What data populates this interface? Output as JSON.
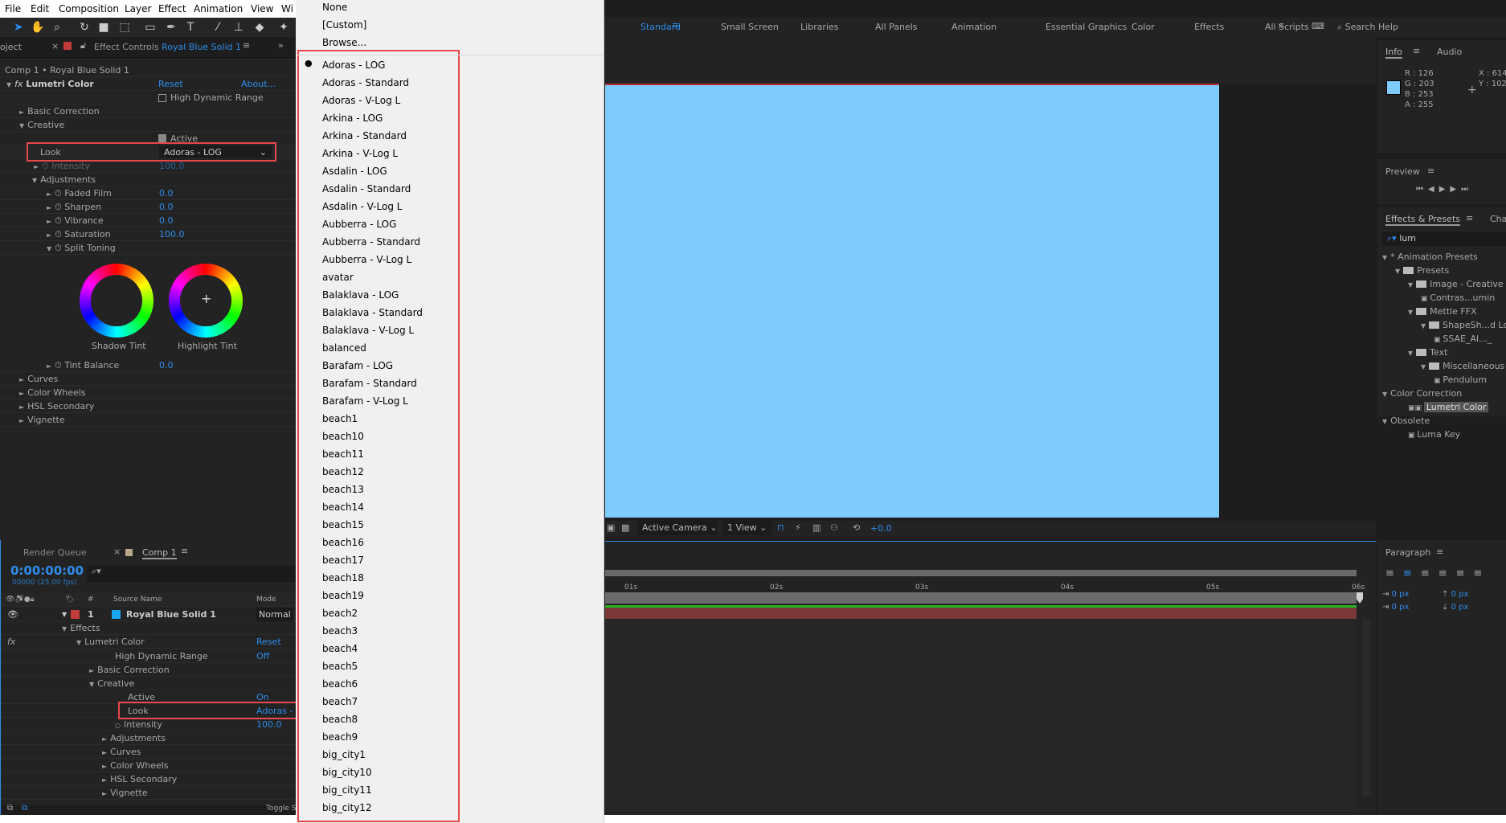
{
  "menu": [
    "File",
    "Edit",
    "Composition",
    "Layer",
    "Effect",
    "Animation",
    "View",
    "Wi"
  ],
  "effect_controls": {
    "tab_left": "oject",
    "tab_title": "Effect Controls",
    "tab_layer": "Royal Blue Solid 1",
    "breadcrumb": "Comp 1 • Royal Blue Solid 1",
    "effect_name": "Lumetri Color",
    "reset": "Reset",
    "about": "About...",
    "hdr": "High Dynamic Range",
    "basic": "Basic Correction",
    "creative": "Creative",
    "active": "Active",
    "look_label": "Look",
    "look_value": "Adoras - LOG",
    "intensity": "Intensity",
    "intensity_value": "100.0",
    "adjustments": "Adjustments",
    "params": [
      {
        "label": "Faded Film",
        "value": "0.0"
      },
      {
        "label": "Sharpen",
        "value": "0.0"
      },
      {
        "label": "Vibrance",
        "value": "0.0"
      },
      {
        "label": "Saturation",
        "value": "100.0"
      }
    ],
    "split_toning": "Split Toning",
    "shadow_tint": "Shadow Tint",
    "highlight_tint": "Highlight Tint",
    "tint_balance": "Tint Balance",
    "tint_balance_value": "0.0",
    "sections": [
      "Curves",
      "Color Wheels",
      "HSL Secondary",
      "Vignette"
    ]
  },
  "dropdown": {
    "top": [
      "None",
      "[Custom]",
      "Browse..."
    ],
    "selected_index": 0,
    "items": [
      "Adoras - LOG",
      "Adoras - Standard",
      "Adoras - V-Log L",
      "Arkina - LOG",
      "Arkina - Standard",
      "Arkina - V-Log L",
      "Asdalin - LOG",
      "Asdalin - Standard",
      "Asdalin - V-Log L",
      "Aubberra - LOG",
      "Aubberra - Standard",
      "Aubberra - V-Log L",
      "avatar",
      "Balaklava - LOG",
      "Balaklava - Standard",
      "Balaklava - V-Log L",
      "balanced",
      "Barafam - LOG",
      "Barafam - Standard",
      "Barafam - V-Log L",
      "beach1",
      "beach10",
      "beach11",
      "beach12",
      "beach13",
      "beach14",
      "beach15",
      "beach16",
      "beach17",
      "beach18",
      "beach19",
      "beach2",
      "beach3",
      "beach4",
      "beach5",
      "beach6",
      "beach7",
      "beach8",
      "beach9",
      "big_city1",
      "big_city10",
      "big_city11",
      "big_city12"
    ]
  },
  "workspaces": [
    "Standard",
    "Small Screen",
    "Libraries",
    "All Panels",
    "Animation",
    "Essential Graphics",
    "Color",
    "Effects",
    "All Scripts"
  ],
  "search_help": "Search Help",
  "viewer": {
    "color": "#7ecbfd",
    "camera": "Active Camera",
    "views": "1 View",
    "exposure": "+0.0"
  },
  "info": {
    "tab": "Info",
    "tab2": "Audio",
    "r": "R : 126",
    "g": "G : 203",
    "b": "B : 253",
    "a": "A : 255",
    "x": "X : 614",
    "y": "Y : 102"
  },
  "preview": {
    "tab": "Preview"
  },
  "effects_presets": {
    "tab": "Effects & Presets",
    "tab2": "Cha",
    "search": "lum",
    "tree": [
      "* Animation Presets",
      "Presets",
      "Image - Creative",
      "Contras...umin",
      "Mettle FFX",
      "ShapeSh...d Lo",
      "SSAE_Al..._",
      "Text",
      "Miscellaneous",
      "Pendulum",
      "Color Correction",
      "Lumetri Color",
      "Obsolete",
      "Luma Key"
    ]
  },
  "paragraph": {
    "tab": "Paragraph",
    "px": "0 px"
  },
  "timeline": {
    "render_queue": "Render Queue",
    "comp_tab": "Comp 1",
    "timecode": "0:00:00:00",
    "fps": "00000 (25.00 fps)",
    "col_num": "#",
    "col_source": "Source Name",
    "col_mode": "Mode",
    "layer_num": "1",
    "layer_name": "Royal Blue Solid 1",
    "layer_mode": "Normal",
    "effects": "Effects",
    "lumetri": "Lumetri Color",
    "reset": "Reset",
    "hdr": "High Dynamic Range",
    "hdr_value": "Off",
    "basic": "Basic Correction",
    "creative": "Creative",
    "active": "Active",
    "active_value": "On",
    "look": "Look",
    "look_value": "Adoras -",
    "intensity": "Intensity",
    "intensity_value": "100.0",
    "adjustments": "Adjustments",
    "sections": [
      "Curves",
      "Color Wheels",
      "HSL Secondary",
      "Vignette"
    ],
    "toggle": "Toggle S",
    "ruler": [
      "01s",
      "02s",
      "03s",
      "04s",
      "05s",
      "06s"
    ]
  }
}
